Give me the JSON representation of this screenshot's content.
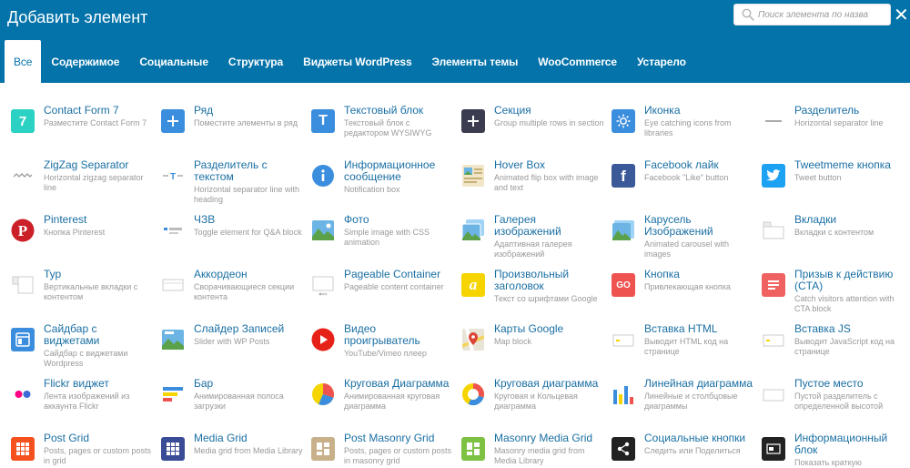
{
  "header": {
    "title": "Добавить элемент",
    "search_placeholder": "Поиск элемента по назва",
    "close_glyph": "✕"
  },
  "tabs": [
    {
      "label": "Все",
      "active": true
    },
    {
      "label": "Содержимое"
    },
    {
      "label": "Социальные"
    },
    {
      "label": "Структура"
    },
    {
      "label": "Виджеты WordPress"
    },
    {
      "label": "Элементы темы"
    },
    {
      "label": "WooCommerce"
    },
    {
      "label": "Устарело"
    }
  ],
  "colors": {
    "header_bg": "#0473aa",
    "link": "#1a6fa3",
    "desc": "#999999"
  },
  "elements": [
    {
      "name": "Contact Form 7",
      "desc": "Разместите Contact Form 7",
      "icon": "contact-form-7-icon"
    },
    {
      "name": "Ряд",
      "desc": "Поместите элементы в ряд",
      "icon": "plus-row-icon"
    },
    {
      "name": "Текстовый блок",
      "desc": "Текстовый блок с редактором WYSIWYG",
      "icon": "text-block-icon"
    },
    {
      "name": "Секция",
      "desc": "Group multiple rows in section",
      "icon": "plus-section-icon"
    },
    {
      "name": "Иконка",
      "desc": "Eye catching icons from libraries",
      "icon": "sun-icon"
    },
    {
      "name": "Разделитель",
      "desc": "Horizontal separator line",
      "icon": "separator-icon"
    },
    {
      "name": "ZigZag Separator",
      "desc": "Horizontal zigzag separator line",
      "icon": "zigzag-icon"
    },
    {
      "name": "Разделитель с текстом",
      "desc": "Horizontal separator line with heading",
      "icon": "text-separator-icon"
    },
    {
      "name": "Информационное сообщение",
      "desc": "Notification box",
      "icon": "info-icon"
    },
    {
      "name": "Hover Box",
      "desc": "Animated flip box with image and text",
      "icon": "hover-box-icon"
    },
    {
      "name": "Facebook лайк",
      "desc": "Facebook \"Like\" button",
      "icon": "facebook-icon"
    },
    {
      "name": "Tweetmeme кнопка",
      "desc": "Tweet button",
      "icon": "twitter-icon"
    },
    {
      "name": "Pinterest",
      "desc": "Кнопка Pinterest",
      "icon": "pinterest-icon"
    },
    {
      "name": "ЧЗВ",
      "desc": "Toggle element for Q&A block",
      "icon": "faq-toggle-icon"
    },
    {
      "name": "Фото",
      "desc": "Simple image with CSS animation",
      "icon": "image-icon"
    },
    {
      "name": "Галерея изображений",
      "desc": "Адаптивная галерея изображений",
      "icon": "gallery-icon"
    },
    {
      "name": "Карусель Изображений",
      "desc": "Animated carousel with images",
      "icon": "carousel-icon"
    },
    {
      "name": "Вкладки",
      "desc": "Вкладки с контентом",
      "icon": "tabs-icon"
    },
    {
      "name": "Тур",
      "desc": "Вертикальные вкладки с контентом",
      "icon": "tour-icon"
    },
    {
      "name": "Аккордеон",
      "desc": "Сворачивающиеся секции контента",
      "icon": "accordion-icon"
    },
    {
      "name": "Pageable Container",
      "desc": "Pageable content container",
      "icon": "pageable-icon"
    },
    {
      "name": "Произвольный заголовок",
      "desc": "Текст со шрифтами Google",
      "icon": "custom-heading-icon"
    },
    {
      "name": "Кнопка",
      "desc": "Привлекающая кнопка",
      "icon": "button-go-icon"
    },
    {
      "name": "Призыв к действию (CTA)",
      "desc": "Catch visitors attention with CTA block",
      "icon": "cta-icon"
    },
    {
      "name": "Сайдбар с виджетами",
      "desc": "Сайдбар с виджетами Wordpress",
      "icon": "sidebar-icon"
    },
    {
      "name": "Слайдер Записей",
      "desc": "Slider with WP Posts",
      "icon": "post-slider-icon"
    },
    {
      "name": "Видео проигрыватель",
      "desc": "YouTube/Vimeo плеер",
      "icon": "video-player-icon"
    },
    {
      "name": "Карты Google",
      "desc": "Map block",
      "icon": "google-maps-icon"
    },
    {
      "name": "Вставка HTML",
      "desc": "Выводит HTML код на странице",
      "icon": "raw-html-icon"
    },
    {
      "name": "Вставка JS",
      "desc": "Выводит JavaScript код на странице",
      "icon": "raw-js-icon"
    },
    {
      "name": "Flickr виджет",
      "desc": "Лента изображений из аккаунта Flickr",
      "icon": "flickr-icon"
    },
    {
      "name": "Бар",
      "desc": "Анимированная полоса загрузки",
      "icon": "progress-bar-icon"
    },
    {
      "name": "Круговая Диаграмма",
      "desc": "Анимированная круговая диаграмма",
      "icon": "pie-chart-icon"
    },
    {
      "name": "Круговая диаграмма",
      "desc": "Круговая и Кольцевая диаграмма",
      "icon": "donut-chart-icon"
    },
    {
      "name": "Линейная диаграмма",
      "desc": "Линейные и столбцовые диаграммы",
      "icon": "line-chart-icon"
    },
    {
      "name": "Пустое место",
      "desc": "Пустой разделитель с определенной высотой",
      "icon": "empty-space-icon"
    },
    {
      "name": "Post Grid",
      "desc": "Posts, pages or custom posts in grid",
      "icon": "post-grid-icon"
    },
    {
      "name": "Media Grid",
      "desc": "Media grid from Media Library",
      "icon": "media-grid-icon"
    },
    {
      "name": "Post Masonry Grid",
      "desc": "Posts, pages or custom posts in masonry grid",
      "icon": "masonry-grid-icon"
    },
    {
      "name": "Masonry Media Grid",
      "desc": "Masonry media grid from Media Library",
      "icon": "masonry-media-icon"
    },
    {
      "name": "Социальные кнопки",
      "desc": "Следить или Поделиться",
      "icon": "share-icon"
    },
    {
      "name": "Информационный блок",
      "desc": "Показать краткую",
      "icon": "info-block-icon"
    }
  ]
}
